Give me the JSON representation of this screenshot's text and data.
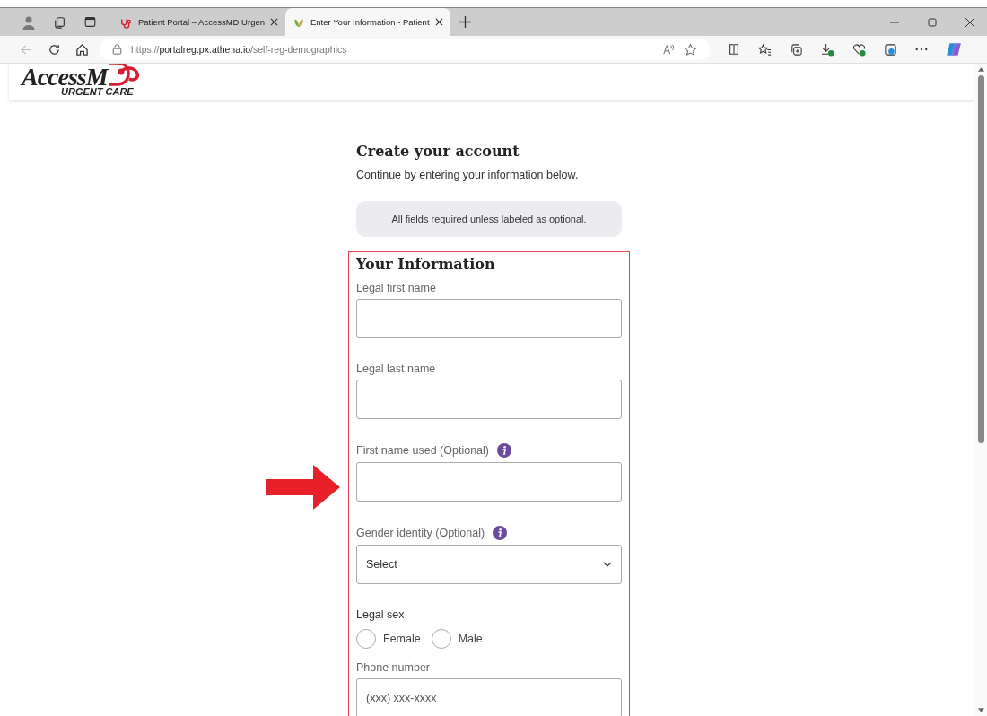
{
  "browser": {
    "tabs": [
      {
        "title": "Patient Portal – AccessMD Urgen",
        "selected": false
      },
      {
        "title": "Enter Your Information - Patient",
        "selected": true
      }
    ],
    "url": {
      "scheme": "https://",
      "host": "portalreg.px.athena.io",
      "path": "/self-reg-demographics"
    }
  },
  "header": {
    "logo_text": "AccessM",
    "logo_subtext": "URGENT CARE"
  },
  "page": {
    "title": "Create your account",
    "subtitle": "Continue by entering your information below.",
    "notice": "All fields required unless labeled as optional.",
    "section_title": "Your Information",
    "fields": [
      {
        "kind": "text",
        "label": "Legal first name",
        "info": false
      },
      {
        "kind": "text",
        "label": "Legal last name",
        "info": false
      },
      {
        "kind": "text",
        "label": "First name used (Optional)",
        "info": true
      },
      {
        "kind": "select",
        "label": "Gender identity (Optional)",
        "info": true,
        "value": "Select"
      },
      {
        "kind": "radio",
        "label": "Legal sex",
        "info": false,
        "options": [
          {
            "label": "Female",
            "selected": false
          },
          {
            "label": "Male",
            "selected": false
          }
        ]
      },
      {
        "kind": "text",
        "label": "Phone number",
        "info": false,
        "placeholder": "(xxx) xxx-xxxx"
      }
    ]
  }
}
